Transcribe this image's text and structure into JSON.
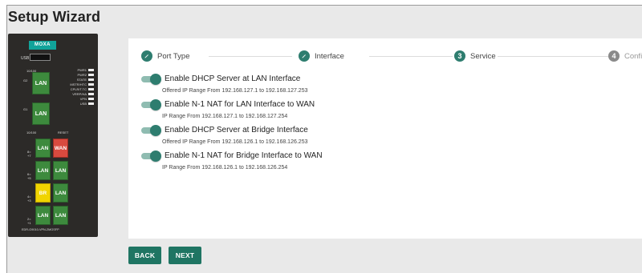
{
  "window": {
    "title": "Setup Wizard"
  },
  "device": {
    "logo": "MOXA",
    "usb_label": "USB",
    "led_labels": [
      "PWR1",
      "PWR2",
      "STATE",
      "MSTR/HTC",
      "CPLR/T.TC",
      "VRRP/HA",
      "VPN",
      "USB"
    ],
    "speed_label_top": "10/100",
    "speed_label_bottom": "10/100",
    "reset_label": "RESET",
    "g2_label": "G2",
    "g1_label": "G1",
    "big_ports": [
      "LAN",
      "LAN"
    ],
    "ports": [
      {
        "label": "LAN",
        "style": "green"
      },
      {
        "label": "WAN",
        "style": "red"
      },
      {
        "label": "LAN",
        "style": "green"
      },
      {
        "label": "LAN",
        "style": "green"
      },
      {
        "label": "BR",
        "style": "yellow"
      },
      {
        "label": "LAN",
        "style": "green"
      },
      {
        "label": "LAN",
        "style": "green"
      },
      {
        "label": "LAN",
        "style": "green"
      }
    ],
    "row_labels": [
      "8= +7",
      "6= +5",
      "4= +3",
      "2= +1"
    ],
    "model": "EDR-G9010-VPN-2MGSFP"
  },
  "stepper": {
    "steps": [
      {
        "label": "Port Type",
        "state": "done",
        "icon": "pencil-icon"
      },
      {
        "label": "Interface",
        "state": "done",
        "icon": "pencil-icon"
      },
      {
        "label": "Service",
        "state": "active",
        "number": "3"
      },
      {
        "label": "Confirm",
        "state": "pending",
        "number": "4"
      }
    ]
  },
  "options": [
    {
      "title": "Enable DHCP Server at LAN Interface",
      "subtitle": "Offered IP Range From 192.168.127.1 to 192.168.127.253",
      "enabled": true
    },
    {
      "title": "Enable N-1 NAT for LAN Interface to WAN",
      "subtitle": "IP Range From 192.168.127.1 to 192.168.127.254",
      "enabled": true
    },
    {
      "title": "Enable DHCP Server at Bridge Interface",
      "subtitle": "Offered IP Range From 192.168.126.1 to 192.168.126.253",
      "enabled": true
    },
    {
      "title": "Enable N-1 NAT for Bridge Interface to WAN",
      "subtitle": "IP Range From 192.168.126.1 to 192.168.126.254",
      "enabled": true
    }
  ],
  "actions": {
    "back_label": "BACK",
    "next_label": "NEXT"
  },
  "colors": {
    "accent": "#1f7563",
    "toggle_track": "#8fbcb1",
    "wan_red": "#d84a3f",
    "lan_green": "#3d8a3d",
    "br_yellow": "#f0d400"
  }
}
